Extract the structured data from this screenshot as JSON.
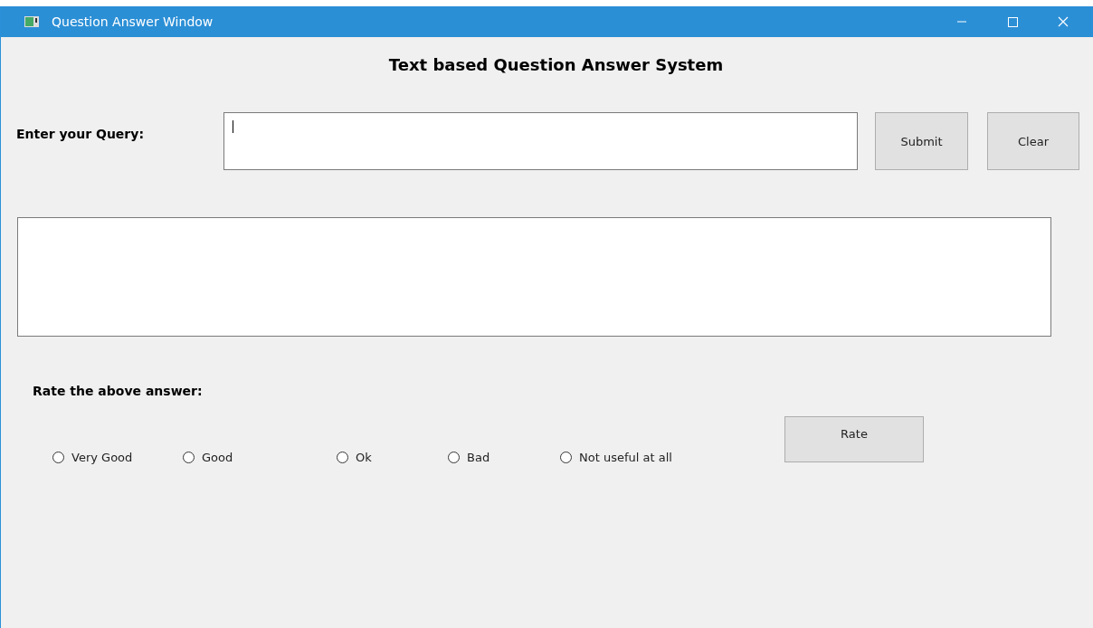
{
  "window": {
    "title": "Question Answer Window"
  },
  "heading": "Text based Question Answer System",
  "query": {
    "label": "Enter your Query:"
  },
  "buttons": [
    "Submit",
    "Clear"
  ],
  "rating": {
    "label": "Rate the above answer:",
    "options": [
      {
        "label": "Very Good",
        "selected": false
      },
      {
        "label": "Good",
        "selected": false
      },
      {
        "label": "Ok",
        "selected": false
      },
      {
        "label": "Bad",
        "selected": false
      },
      {
        "label": "Not useful at all",
        "selected": false
      }
    ],
    "button": "Rate"
  }
}
